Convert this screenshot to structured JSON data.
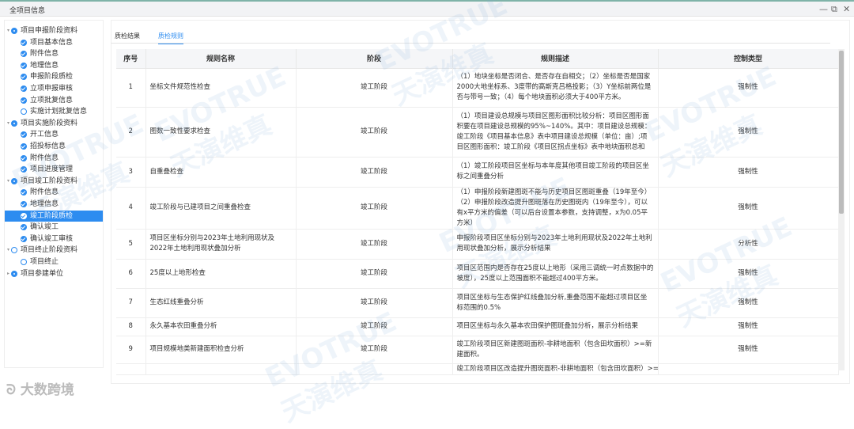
{
  "window": {
    "title": "全项目信息"
  },
  "sidebar": {
    "nodes": [
      {
        "label": "项目申报阶段资料",
        "level": 0,
        "state": "partial"
      },
      {
        "label": "项目基本信息",
        "level": 1,
        "state": "check"
      },
      {
        "label": "附件信息",
        "level": 1,
        "state": "check"
      },
      {
        "label": "地理信息",
        "level": 1,
        "state": "check"
      },
      {
        "label": "申报阶段质检",
        "level": 1,
        "state": "check"
      },
      {
        "label": "立项申报审核",
        "level": 1,
        "state": "check"
      },
      {
        "label": "立项批复信息",
        "level": 1,
        "state": "check"
      },
      {
        "label": "实施计划批复信息",
        "level": 1,
        "state": "empty"
      },
      {
        "label": "项目实施阶段资料",
        "level": 0,
        "state": "partial"
      },
      {
        "label": "开工信息",
        "level": 1,
        "state": "check"
      },
      {
        "label": "招投标信息",
        "level": 1,
        "state": "check"
      },
      {
        "label": "附件信息",
        "level": 1,
        "state": "check"
      },
      {
        "label": "项目进度管理",
        "level": 1,
        "state": "check"
      },
      {
        "label": "项目竣工阶段资料",
        "level": 0,
        "state": "partial"
      },
      {
        "label": "附件信息",
        "level": 1,
        "state": "check"
      },
      {
        "label": "地理信息",
        "level": 1,
        "state": "check"
      },
      {
        "label": "竣工阶段质检",
        "level": 1,
        "state": "check",
        "selected": true
      },
      {
        "label": "确认竣工",
        "level": 1,
        "state": "check"
      },
      {
        "label": "确认竣工审核",
        "level": 1,
        "state": "check"
      },
      {
        "label": "项目终止阶段资料",
        "level": 0,
        "state": "empty"
      },
      {
        "label": "项目终止",
        "level": 1,
        "state": "empty"
      },
      {
        "label": "项目参建单位",
        "level": 0,
        "state": "partial",
        "collapsed": true
      }
    ]
  },
  "tabs": [
    {
      "label": "质检结果"
    },
    {
      "label": "质检规则",
      "active": true
    }
  ],
  "table": {
    "headers": [
      "序号",
      "规则名称",
      "阶段",
      "规则描述",
      "控制类型"
    ],
    "rows": [
      [
        "1",
        "坐标文件规范性检查",
        "竣工阶段",
        "（1）地块坐标是否闭合、是否存在自相交；（2）坐标是否是国家2000大地坐标系、3度带的高斯克吕格投影；（3）Y坐标前两位是否与带号一致；（4）每个地块面积必须大于400平方米。",
        "强制性"
      ],
      [
        "2",
        "图数一致性要求检查",
        "竣工阶段",
        "（1）项目建设总规模与项目区图形面积比较分析：项目区图形面积要在项目建设总规模的95%~140%。其中：项目建设总规模：竣工阶段《项目基本信息》表中项目建设总规模（单位：亩）;项目区图形面积：竣工阶段《项目区拐点坐标》表中地块面积总和",
        "强制性"
      ],
      [
        "3",
        "自重叠检查",
        "竣工阶段",
        "（1）竣工阶段项目区坐标与本年度其他项目竣工阶段的项目区坐标之间重叠分析",
        "强制性"
      ],
      [
        "4",
        "竣工阶段与已建项目之间重叠检查",
        "竣工阶段",
        "（1）申报阶段新建图斑不能与历史项目区图斑重叠（19年至今）（2）申报阶段改造提升图斑落在历史图斑内（19年至今），可以有x平方米的偏差（可以后台设置本参数，支持调整，x为0.05平方米）",
        "强制性"
      ],
      [
        "5",
        "项目区坐标分别与2023年土地利用现状及2022年土地利用现状叠加分析",
        "竣工阶段",
        "申报阶段项目区坐标分别与2023年土地利用现状及2022年土地利用现状叠加分析，展示分析结果",
        "分析性"
      ],
      [
        "6",
        "25度以上地形检查",
        "竣工阶段",
        "项目区范围内是否存在25度以上地形（采用三调统一时点数据中的坡度），25度以上范围面积不能超过400平方米。",
        "强制性"
      ],
      [
        "7",
        "生态红线重叠分析",
        "竣工阶段",
        "项目区坐标与生态保护红线叠加分析,重叠范围不能超过项目区坐标范围的0.5%",
        "强制性"
      ],
      [
        "8",
        "永久基本农田重叠分析",
        "竣工阶段",
        "项目区坐标与永久基本农田保护图斑叠加分析，展示分析结果",
        "强制性"
      ],
      [
        "9",
        "项目规模地类新建面积检查分析",
        "竣工阶段",
        "竣工阶段项目区新建图斑面积-非耕地面积（包含田坎面积）>=新建面积。",
        "强制性"
      ],
      [
        "",
        "",
        "",
        "竣工阶段项目区改造提升图斑面积-非耕地面积（包含田坎面积）>=改",
        ""
      ]
    ]
  },
  "watermark": {
    "text_en": "EVOTRUE",
    "text_cn": "天演维真"
  },
  "logo": {
    "text": "大数跨境"
  }
}
